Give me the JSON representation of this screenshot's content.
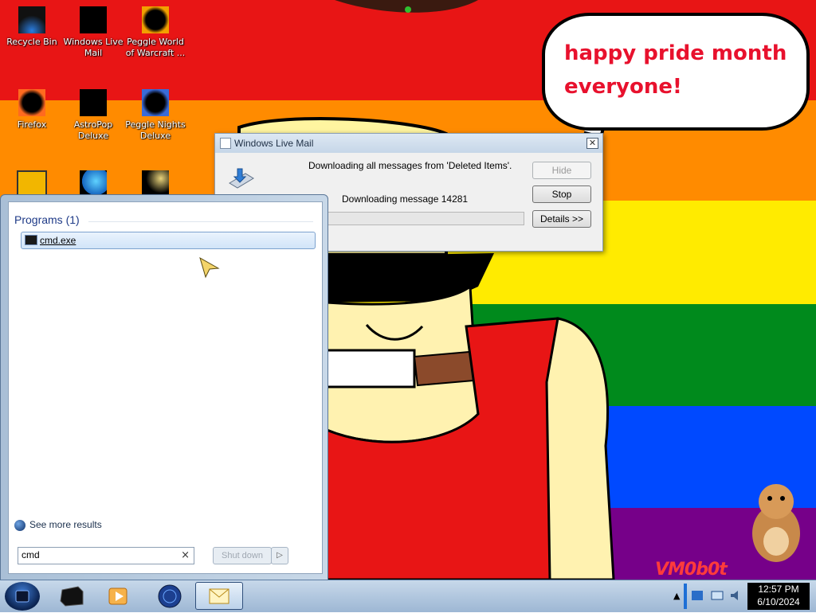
{
  "desktop": {
    "background_colors": [
      "#e81515",
      "#ff8b00",
      "#ffeb00",
      "#008a1c",
      "#0049ff",
      "#760089"
    ],
    "icons": [
      {
        "label": "Recycle Bin",
        "icon": "recycle-bin-icon"
      },
      {
        "label": "Windows Live Mail",
        "icon": "windows-live-mail-icon"
      },
      {
        "label": "Peggle World of Warcraft ...",
        "icon": "peggle-world-of-warcraft-icon"
      },
      {
        "label": "Firefox",
        "icon": "firefox-icon"
      },
      {
        "label": "AstroPop Deluxe",
        "icon": "astropop-deluxe-icon"
      },
      {
        "label": "Peggle Nights Deluxe",
        "icon": "peggle-nights-deluxe-icon"
      }
    ],
    "speech_bubble": {
      "line1": "happy pride month",
      "line2": "everyone!"
    },
    "watermark": "VM0b0t"
  },
  "dialog": {
    "title": "Windows Live Mail",
    "message1": "Downloading all messages from 'Deleted Items'.",
    "message2": "Downloading message 14281",
    "progress_fraction": 0.0,
    "buttons": {
      "hide": "Hide",
      "stop": "Stop",
      "details": "Details >>"
    }
  },
  "start_menu": {
    "section_header": "Programs (1)",
    "result": "cmd.exe",
    "see_more": "See more results",
    "search_value": "cmd",
    "clear_symbol": "×",
    "shutdown_label": "Shut down",
    "shutdown_arrow": "▷"
  },
  "taskbar": {
    "tray_arrow": "▲",
    "clock_time": "12:57 PM",
    "clock_date": "6/10/2024"
  }
}
